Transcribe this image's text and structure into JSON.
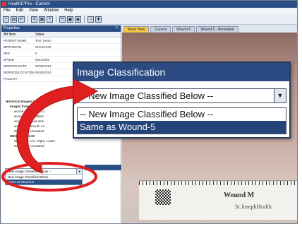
{
  "window": {
    "title": "HealthE*Pro - Current"
  },
  "menu": [
    "File",
    "Edit",
    "View",
    "Window",
    "Help"
  ],
  "toolbar_icons": [
    "save-icon",
    "print-icon",
    "undo-icon",
    "list-icon",
    "grid-icon",
    "zoom-icon",
    "crop-icon",
    "image-icon",
    "camera-icon",
    "measure-icon",
    "wound-icon"
  ],
  "left_panel": {
    "title": "Properties",
    "columns": [
      "Att Item",
      "Value"
    ],
    "rows": [
      {
        "label": "PATIENT NAME",
        "value": "Test, Demo"
      },
      {
        "label": "BIRTHDATE",
        "value": "01/01/1975"
      },
      {
        "label": "SEX",
        "value": "F"
      },
      {
        "label": "EPISID",
        "value": "00123456"
      },
      {
        "label": "SERVICE DATE",
        "value": "05/28/2014"
      },
      {
        "label": "SERVICE/LOCATION",
        "value": "05/28/2014"
      },
      {
        "label": "FACILITY",
        "value": ""
      }
    ],
    "tree": [
      {
        "text": "Historical Images (",
        "bold": true
      },
      {
        "text": "Images from 05/28/2",
        "bold": true
      },
      {
        "text": "wound-1 - Wound: Lo",
        "bold": false
      },
      {
        "text": "wound-1 - Annotated",
        "bold": false
      },
      {
        "text": "wound-1 - Measurem",
        "bold": false
      },
      {
        "text": "wound-3 - Wound: Le",
        "bold": false
      },
      {
        "text": "Wound-3 - Annotated",
        "bold": false
      },
      {
        "text": "05/28/2014 11:32",
        "bold": true
      },
      {
        "text": "Wound-5 - Arm, Right, Lower",
        "bold": false
      },
      {
        "text": "Wound-5 - Annotated",
        "bold": false
      }
    ]
  },
  "tabs": [
    {
      "label": "Move Here",
      "active": true
    },
    {
      "label": "Current",
      "active": false
    },
    {
      "label": "Wound-5",
      "active": false
    },
    {
      "label": "Wound-5 - Annotated",
      "active": false
    }
  ],
  "image_classification": {
    "title": "Image Classification",
    "selected": "-- New Image Classified Below --",
    "options": [
      {
        "label": "-- New Image Classified Below --",
        "selected": false
      },
      {
        "label": "Same as Wound-5",
        "selected": true
      }
    ]
  },
  "mini_dropdown": {
    "value": "New Image Classified Below --",
    "options": [
      {
        "label": "New Image Classified Below ...",
        "selected": false
      },
      {
        "label": "Same as Wound-5",
        "selected": true
      }
    ]
  },
  "scale_card": {
    "brand_line1": "Wound M",
    "brand_line2": "St.JosephHealth"
  },
  "annotation": {
    "arrow_color": "#e02020",
    "ellipse_color": "#e02020"
  },
  "colors": {
    "title_blue": "#2b4b82",
    "selection_blue": "#24437a",
    "active_tab": "#f4c84a"
  }
}
